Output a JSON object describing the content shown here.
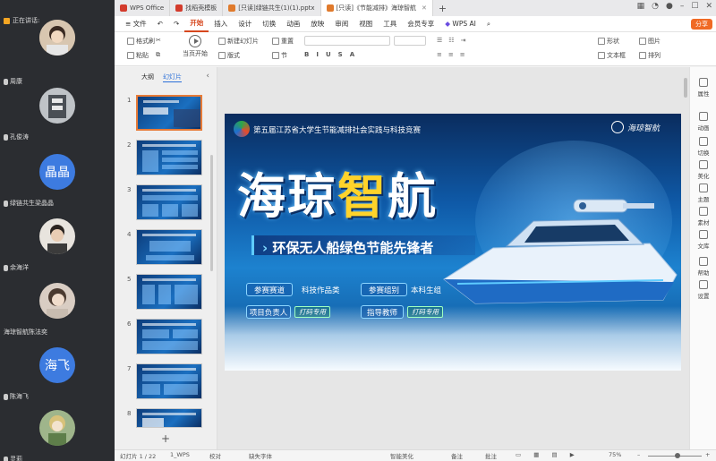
{
  "meeting": {
    "speaking_label": "正在讲话:",
    "participants": [
      {
        "name": "",
        "avatar_text": "",
        "avatar_color": "#c9b8a3",
        "muted": false
      },
      {
        "name": "周康",
        "avatar_text": "",
        "avatar_color": "#7a6a5a",
        "muted": true
      },
      {
        "name": "孔俊涛",
        "avatar_text": "",
        "avatar_color": "#9aa0a6",
        "muted": true
      },
      {
        "name": "绿链共生梁晶晶",
        "avatar_text": "晶晶",
        "avatar_color": "#3d7be0",
        "muted": true
      },
      {
        "name": "余海洋",
        "avatar_text": "",
        "avatar_color": "#8b8178",
        "muted": true
      },
      {
        "name": "海琼智航陈法奕",
        "avatar_text": "",
        "avatar_color": "#b8a69a",
        "muted": false
      },
      {
        "name": "陈海飞",
        "avatar_text": "海飞",
        "avatar_color": "#3d7be0",
        "muted": true
      },
      {
        "name": "灵莉",
        "avatar_text": "",
        "avatar_color": "#8fa37a",
        "muted": false
      }
    ]
  },
  "tabs": [
    {
      "label": "WPS Office",
      "color": "#d33b2c"
    },
    {
      "label": "找稻壳模板",
      "color": "#d33b2c"
    },
    {
      "label": "[只读]绿链共生(1)(1).pptx",
      "color": "#e07a2c"
    },
    {
      "label": "[只读]《节能减排》海琼智航",
      "color": "#e07a2c"
    }
  ],
  "menu": {
    "file": "文件",
    "items": [
      "开始",
      "插入",
      "设计",
      "切换",
      "动画",
      "放映",
      "审阅",
      "视图",
      "工具",
      "会员专享"
    ],
    "active": "开始",
    "ai": "WPS AI",
    "share": "分享"
  },
  "ribbon": {
    "format_painter": "格式刷",
    "paste": "粘贴",
    "play": "当页开始",
    "new_slide": "新建幻灯片",
    "layout": "版式",
    "reset": "重置",
    "section": "节",
    "shape": "形状",
    "picture": "图片",
    "textbox": "文本框",
    "arrange": "排列"
  },
  "slides_pane": {
    "tab_outline": "大纲",
    "tab_slides": "幻灯片",
    "numbers": [
      "1",
      "2",
      "3",
      "4",
      "5",
      "6",
      "7",
      "8"
    ],
    "add": "+"
  },
  "slide": {
    "contest_title": "第五届江苏省大学生节能减排社会实践与科技竞赛",
    "team_logo_text": "海琼智航",
    "title_part1": "海琼",
    "title_part2": "智",
    "title_part3": "航",
    "subtitle": "环保无人船绿色节能先锋者",
    "track_label": "参赛赛道",
    "track_value": "科技作品类",
    "group_label": "参赛组别",
    "group_value": "本科生组",
    "leader_label": "项目负责人",
    "leader_value": "打码专用",
    "advisor_label": "指导教师",
    "advisor_value": "打码专用"
  },
  "side_panel": [
    "属性",
    "动画",
    "切换",
    "美化",
    "主题",
    "素材",
    "文库",
    "帮助",
    "设置"
  ],
  "status": {
    "slide_index": "幻灯片 1 / 22",
    "theme": "1_WPS",
    "proof": "校对",
    "font_missing": "缺失字体",
    "smart_beautify": "智能美化",
    "notes": "备注",
    "comments": "批注",
    "zoom": "75%"
  }
}
